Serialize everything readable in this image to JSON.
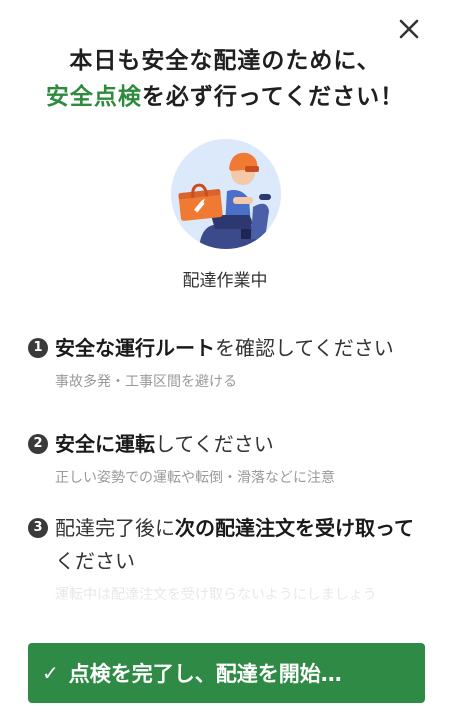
{
  "title": {
    "line1": "本日も安全な配達のために、",
    "line2_accent": "安全点検",
    "line2_rest": "を必ず行ってください！"
  },
  "hero": {
    "caption": "配達作業中",
    "icon": "delivery-rider-illustration"
  },
  "steps": [
    {
      "number": "1",
      "bold": "安全な運行ルート",
      "rest": "を確認してください",
      "sub": "事故多発・工事区間を避ける"
    },
    {
      "number": "2",
      "bold": "安全に運転",
      "rest": "してください",
      "sub": "正しい姿勢での運転や転倒・滑落などに注意"
    },
    {
      "number": "3",
      "pre": "配達完了後に",
      "bold": "次の配達注文を受け取って",
      "rest": "ください",
      "sub": "運転中は配達注文を受け取らないようにしましょう"
    }
  ],
  "cta": {
    "label": "点検を完了し、配達を開始…",
    "check_icon": "checkmark-icon"
  },
  "colors": {
    "accent": "#2e8b3e",
    "button": "#2f8a46",
    "hero_bg": "#dbe9fb",
    "helmet": "#f07a33"
  }
}
